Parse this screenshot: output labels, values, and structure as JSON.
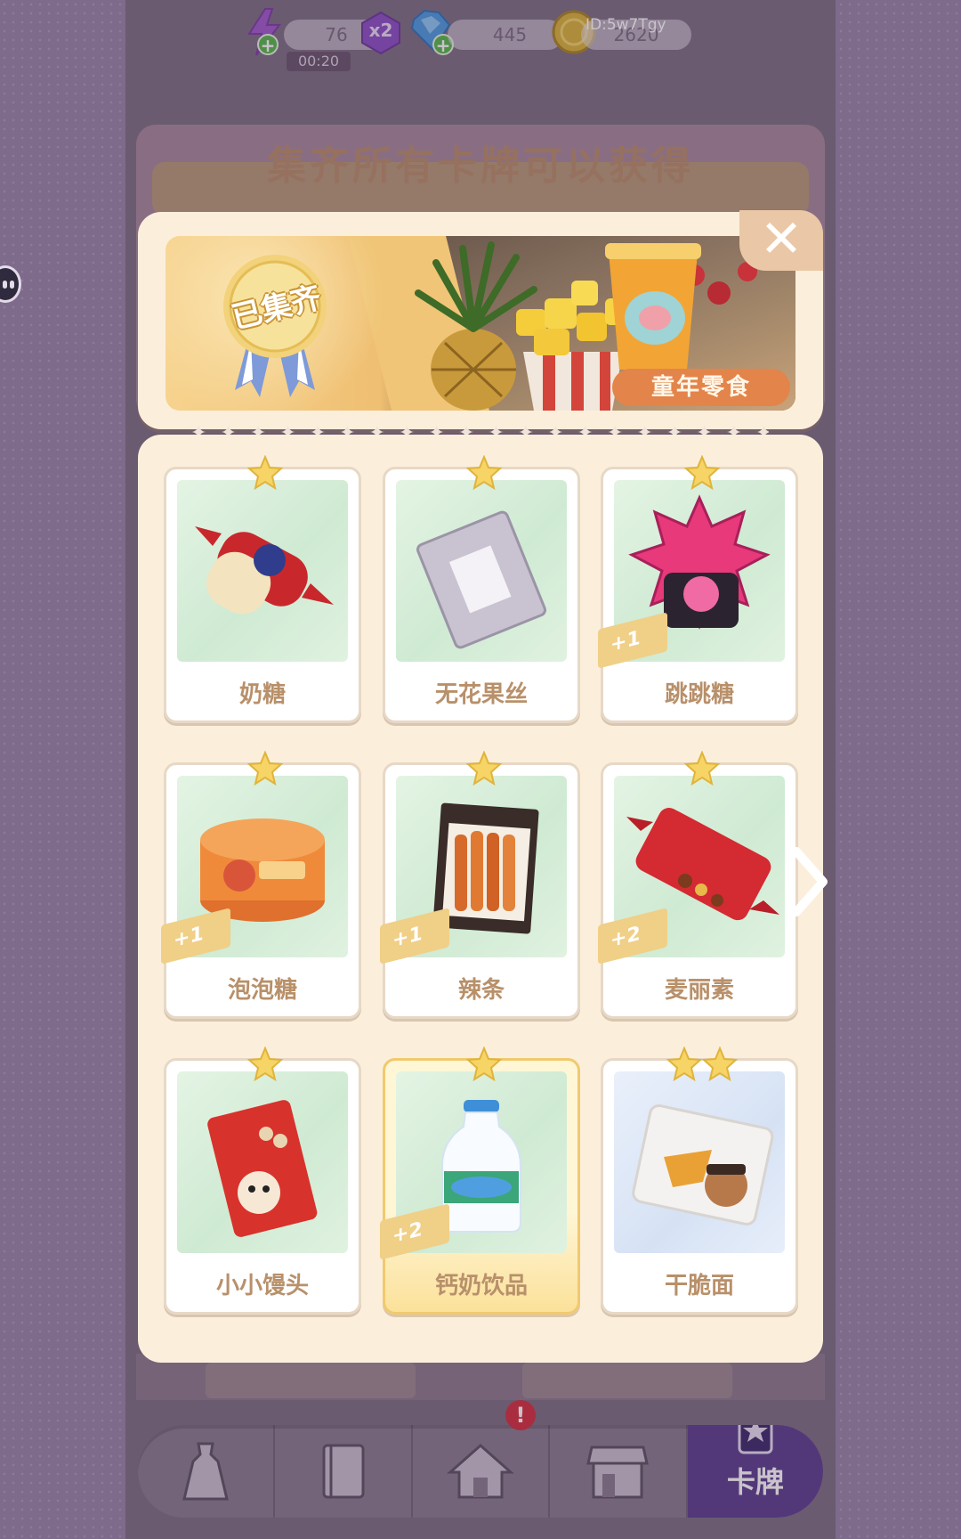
{
  "resources": {
    "energy": "76",
    "energy_timer": "00:20",
    "multiplier": "x2",
    "gems": "445",
    "coins": "2620",
    "player_id": "ID:5w7Tgy"
  },
  "background": {
    "title": "集齐所有卡牌可以获得"
  },
  "popup": {
    "collected_badge": "已集齐",
    "collection_name": "童年零食",
    "close_icon": "close-icon"
  },
  "cards": [
    {
      "name": "奶糖",
      "stars": 1,
      "plus": ""
    },
    {
      "name": "无花果丝",
      "stars": 1,
      "plus": ""
    },
    {
      "name": "跳跳糖",
      "stars": 1,
      "plus": "+1"
    },
    {
      "name": "泡泡糖",
      "stars": 1,
      "plus": "+1"
    },
    {
      "name": "辣条",
      "stars": 1,
      "plus": "+1"
    },
    {
      "name": "麦丽素",
      "stars": 1,
      "plus": "+2"
    },
    {
      "name": "小小馒头",
      "stars": 1,
      "plus": ""
    },
    {
      "name": "钙奶饮品",
      "stars": 1,
      "plus": "+2"
    },
    {
      "name": "干脆面",
      "stars": 2,
      "plus": ""
    }
  ],
  "nav": {
    "items": [
      "dress-icon",
      "book-icon",
      "home-icon",
      "shop-icon",
      "cards-icon"
    ],
    "active_label": "卡牌",
    "alert": "!"
  },
  "colors": {
    "accent": "#5b3f8e",
    "card_name": "#b8906a",
    "badge_tag": "#e3844a"
  }
}
